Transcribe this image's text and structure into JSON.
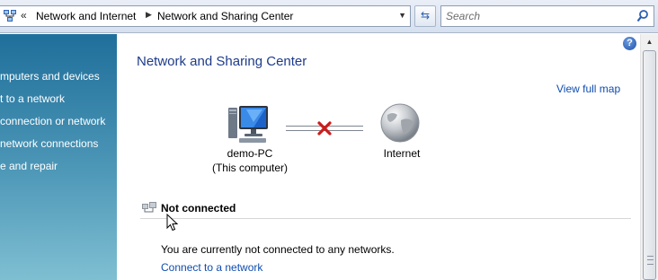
{
  "address_bar": {
    "overflow": "«",
    "breadcrumbs": [
      "Network and Internet",
      "Network and Sharing Center"
    ],
    "separator": "▶",
    "dropdown": "▼",
    "refresh_glyph": "⇆"
  },
  "search": {
    "placeholder": "Search"
  },
  "left_pane": {
    "tasks": [
      "mputers and devices",
      "t to a network",
      " connection or network",
      " network connections",
      "e and repair"
    ]
  },
  "help": {
    "glyph": "?"
  },
  "main": {
    "title": "Network and Sharing Center",
    "view_full_map": "View full map",
    "map": {
      "computer_name": "demo-PC",
      "computer_sublabel": "(This computer)",
      "internet_label": "Internet",
      "connection_status_icon": "red-x-icon"
    },
    "status": {
      "title": "Not connected",
      "message": "You are currently not connected to any networks.",
      "connect_link": "Connect to a network"
    }
  },
  "scrollbar": {
    "up_glyph": "▲"
  },
  "colors": {
    "title_blue": "#1e3b8a",
    "link_blue": "#0f4cb0",
    "pane_top": "#1f6f9b",
    "pane_bottom": "#7fbfd2",
    "disconnected_red": "#cc1b1b"
  }
}
